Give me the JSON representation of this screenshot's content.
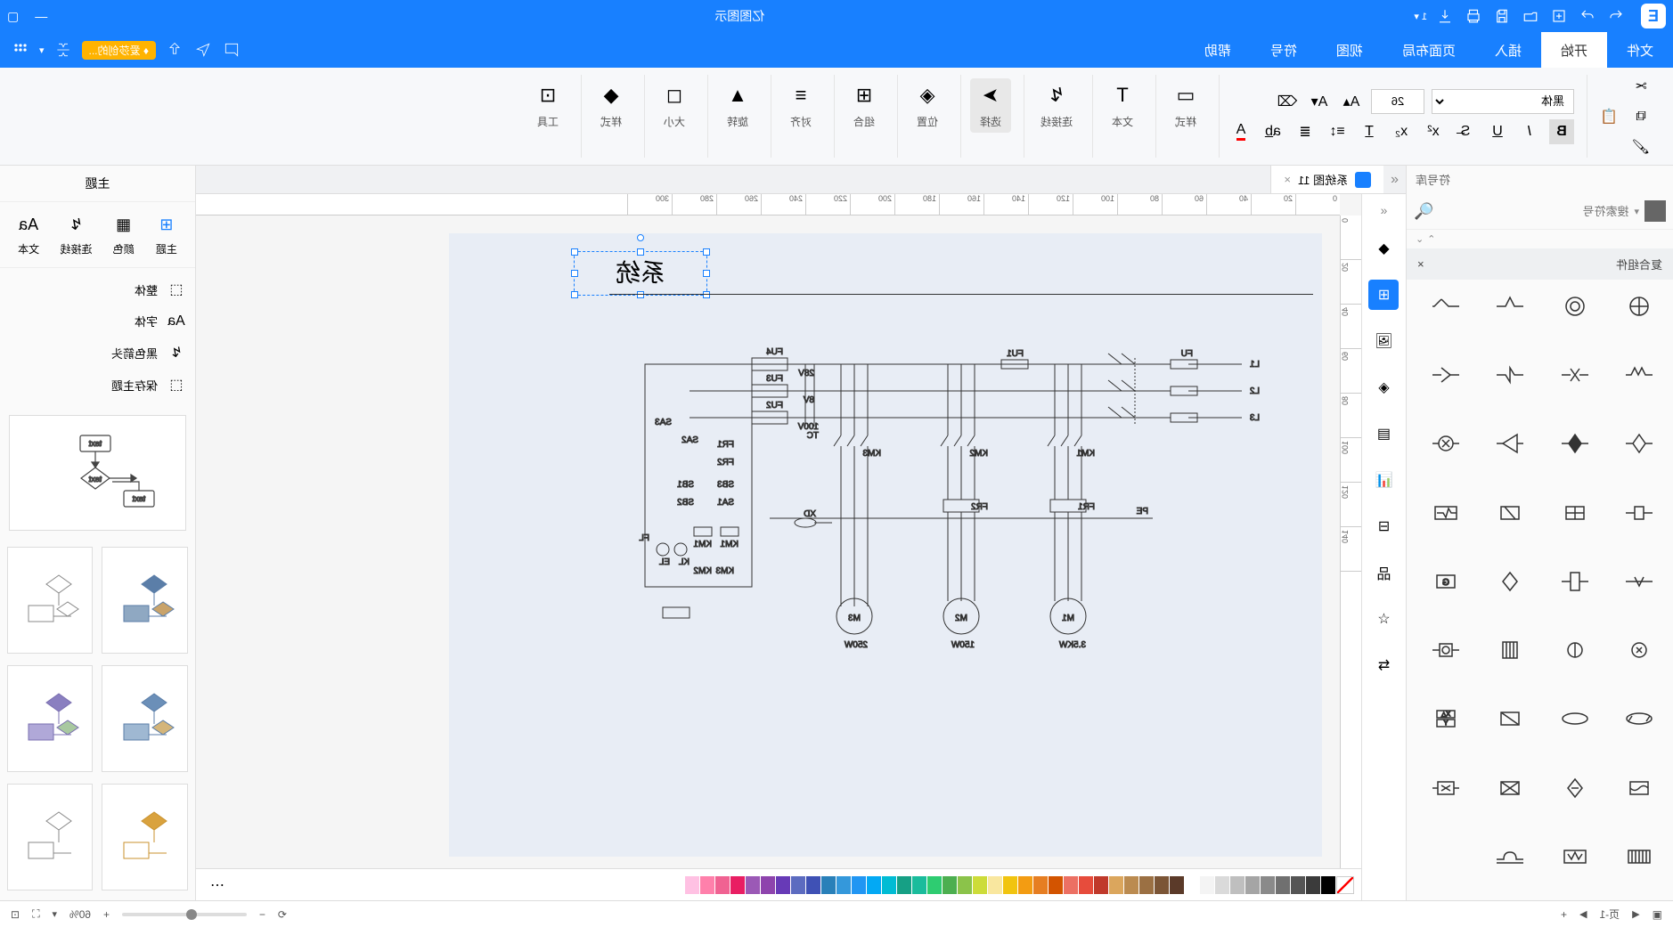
{
  "app": {
    "title": "亿图图示"
  },
  "menu": {
    "items": [
      "文件",
      "开始",
      "插入",
      "页面布局",
      "视图",
      "符号",
      "帮助"
    ],
    "active_index": 1,
    "right_badge": "爱莎创的..."
  },
  "ribbon": {
    "font_name": "黑体",
    "font_size": "26",
    "groups": {
      "style": "样式",
      "text": "文本",
      "connector": "连接线",
      "select": "选择",
      "position": "位置",
      "group": "组合",
      "align": "对齐",
      "rotate": "旋转",
      "size": "大小",
      "style2": "样式",
      "tools": "工具"
    }
  },
  "doc_tab": {
    "name": "系统图 11"
  },
  "left": {
    "search_placeholder": "搜索符号",
    "section": "复合组件"
  },
  "right": {
    "head": "主题",
    "modes": [
      "主题",
      "颜色",
      "连接线",
      "文本"
    ],
    "nav": [
      "整体",
      "字体",
      "黑色箭头",
      "保存主题"
    ]
  },
  "canvas": {
    "selected_text": "系统",
    "ruler_h": [
      "0",
      "20",
      "40",
      "60",
      "80",
      "100",
      "120",
      "140",
      "160",
      "180",
      "200",
      "220",
      "240",
      "260",
      "280",
      "300"
    ],
    "ruler_v": [
      "0",
      "20",
      "40",
      "60",
      "80",
      "100",
      "120",
      "140"
    ],
    "circuit_labels": {
      "l1": "L1",
      "l2": "L2",
      "l3": "L3",
      "fu": "FU",
      "fu1": "FU1",
      "fu2": "FU2",
      "fu3": "FU3",
      "fu4": "FU4",
      "km1": "KM1",
      "km2": "KM2",
      "km3": "KM3",
      "fr1": "FR1",
      "fr2": "FR2",
      "m1": "M1",
      "m2": "M2",
      "m3": "M3",
      "m1_power": "3.5KW",
      "m2_power": "150W",
      "m3_power": "250W",
      "pe": "PE",
      "tc": "TC",
      "v28": "28V",
      "v8": "8V",
      "v100": "100V",
      "sa1": "SA1",
      "sa2": "SA2",
      "sa3": "SA3",
      "sb1": "SB1",
      "sb2": "SB2",
      "sb3": "SB3",
      "xd": "XD",
      "fl": "FL",
      "kl": "KL",
      "el": "EL"
    }
  },
  "status": {
    "page_label": "页-1",
    "zoom": "60%"
  },
  "colors": [
    "#000000",
    "#3b3b3b",
    "#555555",
    "#707070",
    "#8a8a8a",
    "#a5a5a5",
    "#bfbfbf",
    "#dadada",
    "#f4f4f4",
    "#ffffff",
    "#5b3a29",
    "#7b5536",
    "#9b7043",
    "#bb8b50",
    "#dba65d",
    "#c0392b",
    "#e74c3c",
    "#ec7063",
    "#d35400",
    "#e67e22",
    "#f39c12",
    "#f1c40f",
    "#f9e79f",
    "#cddc39",
    "#8bc34a",
    "#4caf50",
    "#2ecc71",
    "#1abc9c",
    "#16a085",
    "#00bcd4",
    "#03a9f4",
    "#2196f3",
    "#3498db",
    "#2980b9",
    "#3f51b5",
    "#5c6bc0",
    "#673ab7",
    "#8e44ad",
    "#9b59b6",
    "#e91e63",
    "#f06292",
    "#ff80ab",
    "#ffc1e3"
  ]
}
